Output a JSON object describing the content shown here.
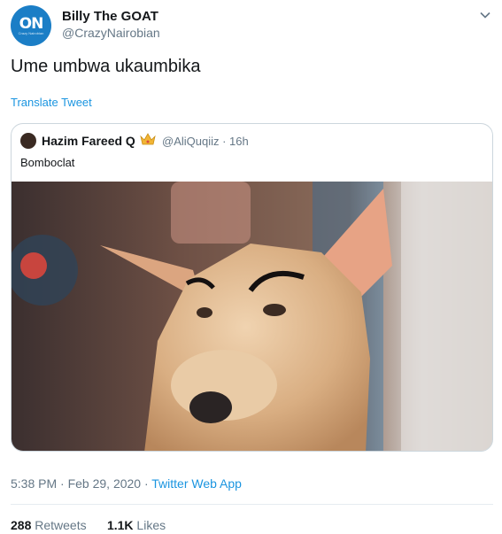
{
  "author": {
    "avatar_text": "ON",
    "avatar_subtext": "Crazy Nairobian",
    "name": "Billy The GOAT",
    "handle": "@CrazyNairobian"
  },
  "tweet": {
    "text": "Ume umbwa ukaumbika",
    "translate_label": "Translate Tweet"
  },
  "quoted": {
    "name": "Hazim Fareed Q",
    "badge_icon": "crown-icon",
    "handle_time": "@AliQuqiiz · 16h",
    "text": "Bomboclat",
    "image_alt": "dog with drawn eyebrows"
  },
  "meta": {
    "timestamp": "5:38 PM · Feb 29, 2020 · ",
    "source": "Twitter Web App"
  },
  "stats": {
    "retweets_count": "288",
    "retweets_label": "Retweets",
    "likes_count": "1.1K",
    "likes_label": "Likes"
  },
  "colors": {
    "link": "#1b95e0",
    "secondary": "#657786",
    "avatar": "#1b7ec6"
  }
}
